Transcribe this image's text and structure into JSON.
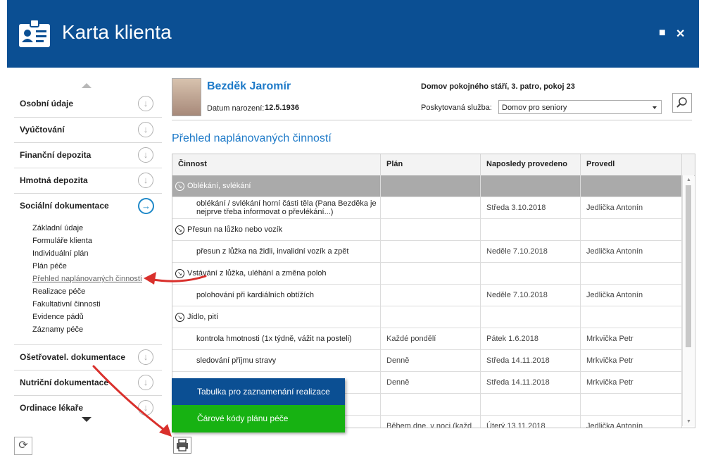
{
  "window": {
    "title": "Karta klienta",
    "maximize_icon": "maximize-icon",
    "close_icon": "close-icon"
  },
  "sidebar": {
    "sections": [
      {
        "label": "Osobní údaje"
      },
      {
        "label": "Vyúčtování"
      },
      {
        "label": "Finanční depozita"
      },
      {
        "label": "Hmotná depozita"
      },
      {
        "label": "Sociální dokumentace",
        "active": true
      },
      {
        "label": "Ošetřovatel. dokumentace"
      },
      {
        "label": "Nutriční dokumentace"
      },
      {
        "label": "Ordinace lékaře"
      }
    ],
    "subitems": [
      "Základní údaje",
      "Formuláře klienta",
      "Individuální plán",
      "Plán péče",
      "Přehled naplánovaných činností",
      "Realizace péče",
      "Fakultativní činnosti",
      "Evidence pádů",
      "Záznamy péče"
    ],
    "selected_subitem": "Přehled naplánovaných činností"
  },
  "client": {
    "name": "Bezděk Jaromír",
    "dob_label": "Datum narození:",
    "dob": "12.5.1936",
    "location": "Domov pokojného stáří, 3. patro, pokoj 23",
    "service_label": "Poskytovaná služba:",
    "service_value": "Domov pro seniory"
  },
  "section_title": "Přehled naplánovaných činností",
  "table": {
    "headers": [
      "Činnost",
      "Plán",
      "Naposledy provedeno",
      "Provedl"
    ],
    "rows": [
      {
        "group": true,
        "selected": true,
        "activity": "Oblékání, svlékání",
        "plan": "",
        "last": "",
        "by": ""
      },
      {
        "activity": "oblékání / svlékání horní části těla (Pana Bezděka je nejprve třeba informovat o převlékání...)",
        "plan": "",
        "last": "Středa 3.10.2018",
        "by": "Jedlička Antonín"
      },
      {
        "group": true,
        "activity": "Přesun na lůžko nebo vozík",
        "plan": "",
        "last": "",
        "by": ""
      },
      {
        "activity": "přesun z lůžka na židli, invalidní vozík a zpět",
        "plan": "",
        "last": "Neděle 7.10.2018",
        "by": "Jedlička Antonín"
      },
      {
        "group": true,
        "activity": "Vstávání z lůžka, uléhání a změna poloh",
        "plan": "",
        "last": "",
        "by": ""
      },
      {
        "activity": "polohování při kardiálních obtížích",
        "plan": "",
        "last": "Neděle 7.10.2018",
        "by": "Jedlička Antonín"
      },
      {
        "group": true,
        "activity": "Jídlo, pití",
        "plan": "",
        "last": "",
        "by": ""
      },
      {
        "activity": "kontrola hmotnosti (1x týdně, vážit na posteli)",
        "plan": "Každé pondělí",
        "last": "Pátek 1.6.2018",
        "by": "Mrkvička Petr"
      },
      {
        "activity": "sledování příjmu stravy",
        "plan": "Denně",
        "last": "Středa 14.11.2018",
        "by": "Mrkvička Petr"
      },
      {
        "activity": "",
        "plan": "Denně",
        "last": "Středa 14.11.2018",
        "by": "Mrkvička Petr"
      },
      {
        "activity": "",
        "plan": "",
        "last": "",
        "by": ""
      },
      {
        "activity": "",
        "plan": "Během dne, v noci (každ",
        "last": "Úterý 13.11.2018",
        "by": "Jedlička Antonín"
      }
    ]
  },
  "popup": {
    "item1": "Tabulka pro zaznamenání realizace",
    "item2": "Čárové kódy plánu péče"
  },
  "colors": {
    "header": "#0b4f93",
    "accent": "#1e7ac8",
    "green": "#17b212",
    "arrow": "#d9302c"
  }
}
